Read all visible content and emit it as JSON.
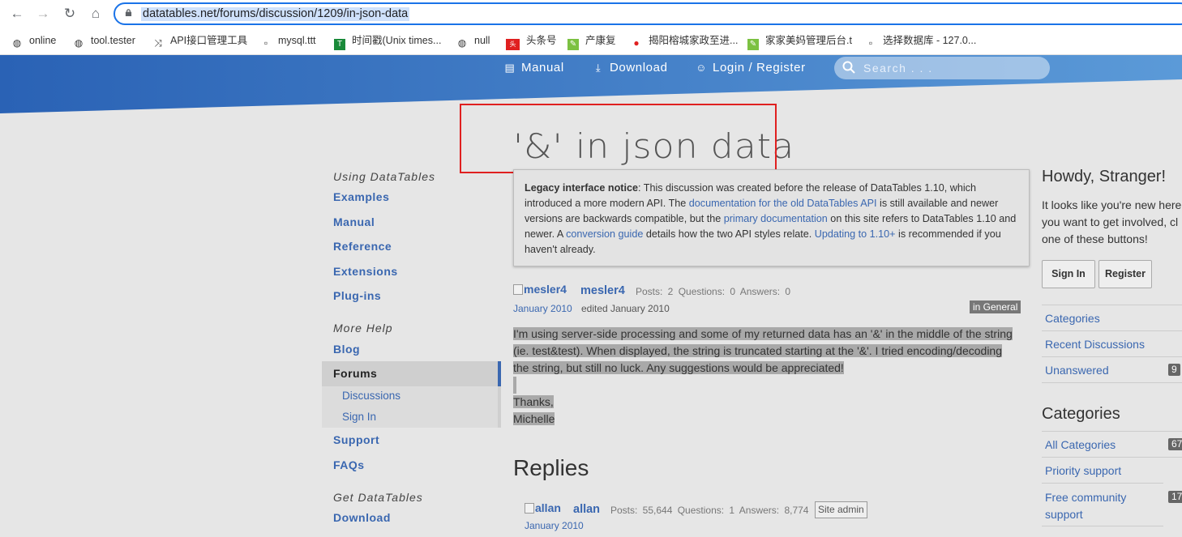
{
  "browser": {
    "url": "datatables.net/forums/discussion/1209/in-json-data",
    "bookmarks": [
      {
        "label": "online",
        "icon": "globe-icon"
      },
      {
        "label": "tool.tester",
        "icon": "globe-icon"
      },
      {
        "label": "API接口管理工具",
        "icon": "shuffle-icon"
      },
      {
        "label": "mysql.ttt",
        "icon": "page-icon"
      },
      {
        "label": "时间戳(Unix times...",
        "icon": "green-box-icon"
      },
      {
        "label": "null",
        "icon": "globe-icon"
      },
      {
        "label": "头条号",
        "icon": "red-badge-icon"
      },
      {
        "label": "产康复",
        "icon": "leaf-icon"
      },
      {
        "label": "揭阳榕城家政至进...",
        "icon": "pin-icon"
      },
      {
        "label": "家家美妈管理后台.t",
        "icon": "leaf-icon"
      },
      {
        "label": "选择数据库 - 127.0...",
        "icon": "page-icon"
      }
    ]
  },
  "topnav": {
    "manual": "Manual",
    "download": "Download",
    "login": "Login / Register",
    "search_placeholder": "Search . . ."
  },
  "page": {
    "title": "'&' in json data"
  },
  "sidebar": {
    "sections": [
      {
        "heading": "Using DataTables",
        "links": [
          "Examples",
          "Manual",
          "Reference",
          "Extensions",
          "Plug-ins"
        ]
      },
      {
        "heading": "More Help",
        "links": [
          "Blog",
          "Forums",
          "Support",
          "FAQs"
        ]
      },
      {
        "heading": "Get DataTables",
        "links": [
          "Download"
        ]
      }
    ],
    "forums_sub": [
      "Discussions",
      "Sign In"
    ]
  },
  "notice": {
    "bold": "Legacy interface notice",
    "t1": ": This discussion was created before the release of DataTables 1.10, which introduced a more modern API. The ",
    "link1": "documentation for the old DataTables API",
    "t2": " is still available and newer versions are backwards compatible, but the ",
    "link2": "primary documentation",
    "t3": " on this site refers to DataTables 1.10 and newer. A ",
    "link3": "conversion guide",
    "t4": " details how the two API styles relate. ",
    "link4": "Updating to 1.10+",
    "t5": " is recommended if you haven't already."
  },
  "post": {
    "avatar_alt": "mesler4",
    "username": "mesler4",
    "stats": "Posts: 2   Questions: 0   Answers: 0",
    "date": "January 2010",
    "edited": "edited January 2010",
    "category_badge": "in General",
    "body_lines": [
      "I'm using server-side processing and some of my returned data has an '&' in the middle of the string",
      "(ie. test&test). When displayed, the string is truncated starting at the '&'. I tried encoding/decoding",
      "the string, but still no luck. Any suggestions would be appreciated!"
    ],
    "thanks": "Thanks,",
    "signature": "Michelle"
  },
  "replies": {
    "heading": "Replies",
    "first": {
      "avatar_alt": "allan",
      "username": "allan",
      "stats": "Posts: 55,644   Questions: 1   Answers: 8,774",
      "role": "Site admin",
      "date": "January 2010"
    }
  },
  "right": {
    "howdy": "Howdy, Stranger!",
    "howdy_lines": [
      "It looks like you're new here",
      "you want to get involved, cl",
      "one of these buttons!"
    ],
    "signin": "Sign In",
    "register": "Register",
    "links": [
      {
        "label": "Categories",
        "count": ""
      },
      {
        "label": "Recent Discussions",
        "count": ""
      },
      {
        "label": "Unanswered",
        "count": "9"
      }
    ],
    "categories_heading": "Categories",
    "categories": [
      {
        "label": "All Categories",
        "count": "67"
      },
      {
        "label": "Priority support",
        "count": ""
      },
      {
        "label": "Free community support",
        "count": "17"
      }
    ]
  },
  "colors": {
    "link": "#3a67b0",
    "hero_left": "#2a62b5",
    "hero_right": "#5b9ad8",
    "highlight_box": "#e02020"
  }
}
